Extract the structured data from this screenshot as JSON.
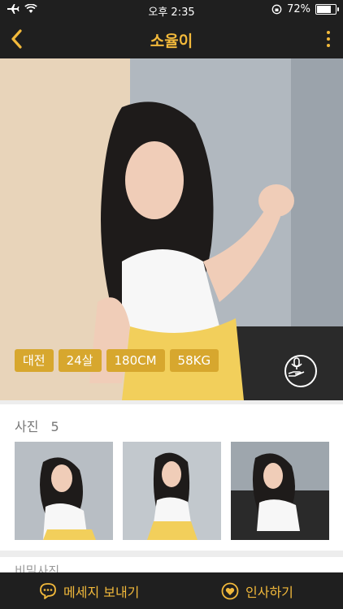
{
  "status": {
    "time": "오후 2:35",
    "battery": "72%"
  },
  "nav": {
    "title": "소율이"
  },
  "profile": {
    "tags": [
      "대전",
      "24살",
      "180CM",
      "58KG"
    ]
  },
  "photos": {
    "title": "사진",
    "count": "5"
  },
  "secret": {
    "title": "비밀사진"
  },
  "actions": {
    "message": "메세지 보내기",
    "greet": "인사하기"
  },
  "colors": {
    "accent": "#f2b93b",
    "tag": "#d7a72e",
    "bar": "#1f1f1f"
  }
}
